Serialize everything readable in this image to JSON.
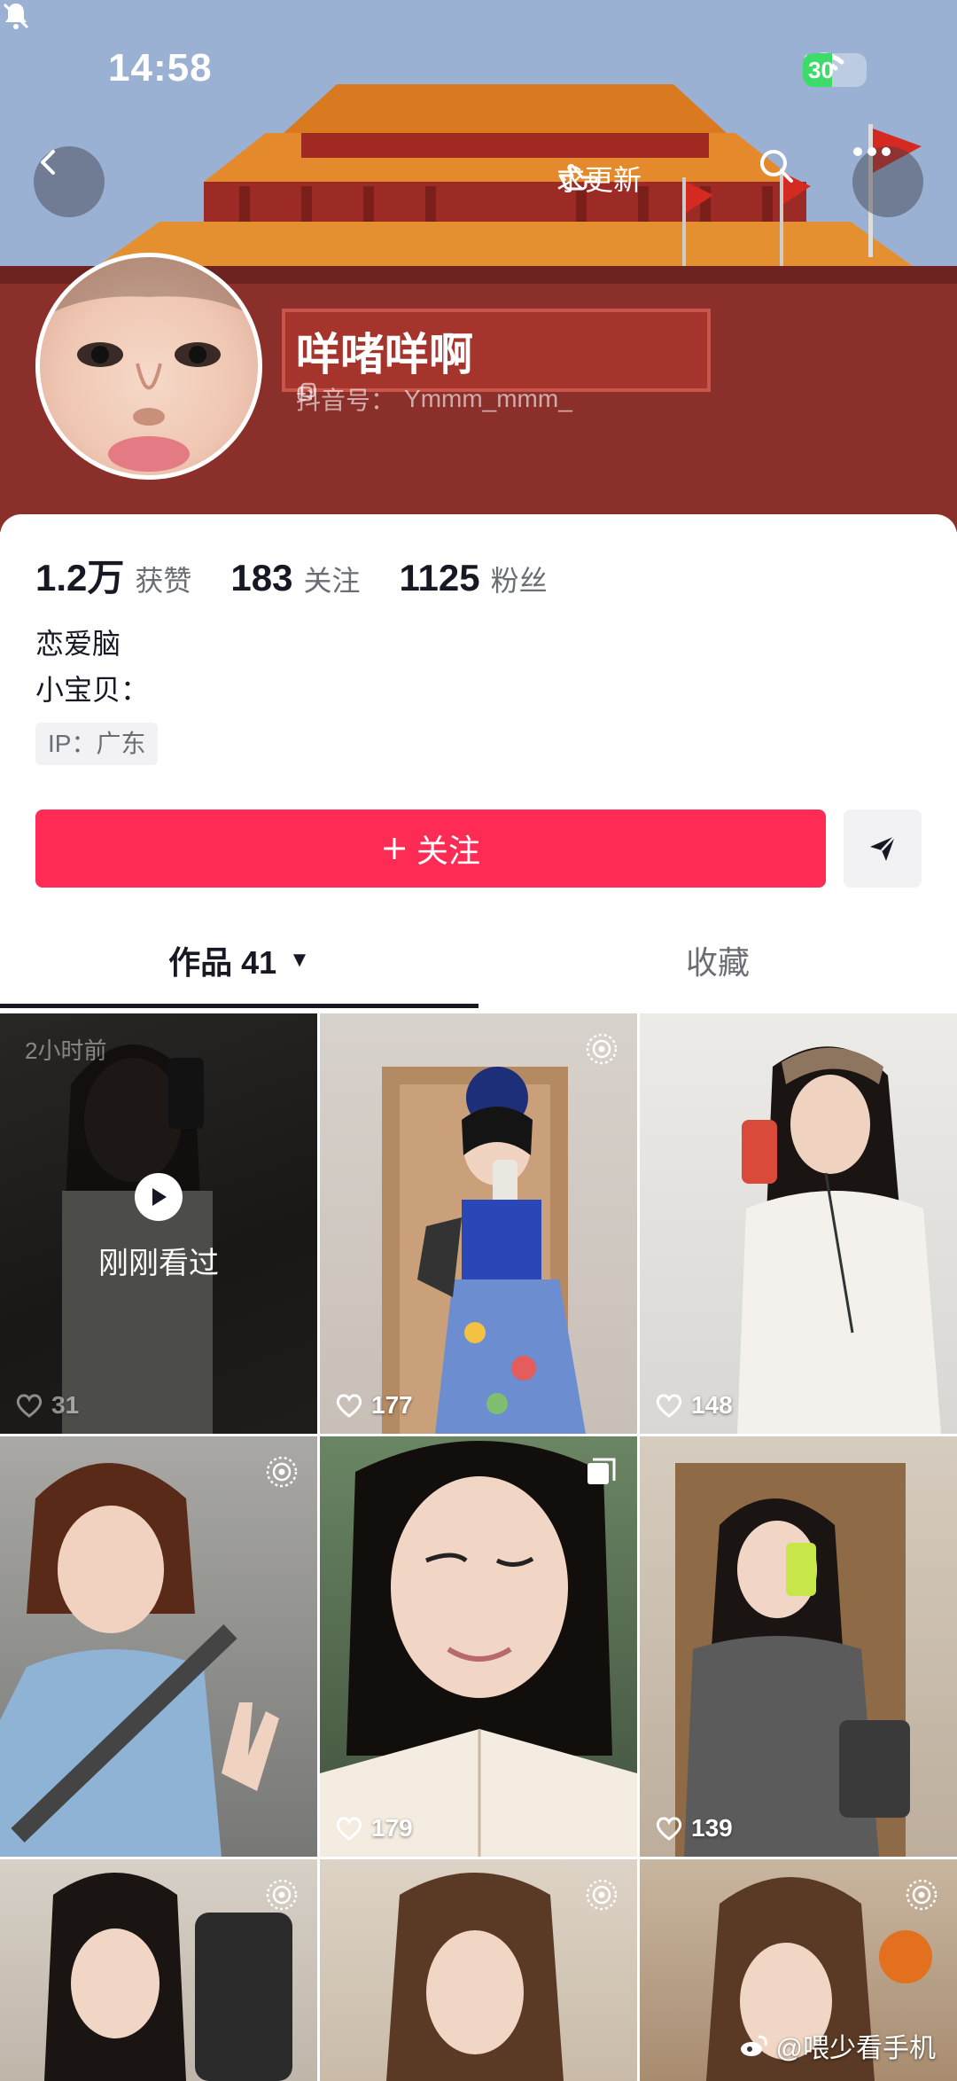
{
  "status_bar": {
    "time": "14:58",
    "battery": "30"
  },
  "header": {
    "update_label": "求更新",
    "nickname": "咩啫咩啊",
    "douyin_id_label": "抖音号：",
    "douyin_id": "Ymmm_mmm_"
  },
  "stats": [
    {
      "num": "1.2万",
      "label": "获赞"
    },
    {
      "num": "183",
      "label": "关注"
    },
    {
      "num": "1125",
      "label": "粉丝"
    }
  ],
  "bio": {
    "line1": "恋爱脑",
    "line2": "小宝贝："
  },
  "ip": "IP：广东",
  "follow_label": "关注",
  "tabs": {
    "works": "作品 41",
    "favorites": "收藏"
  },
  "videos": [
    {
      "likes": "31",
      "time_ago": "2小时前",
      "watched_label": "刚刚看过"
    },
    {
      "likes": "177"
    },
    {
      "likes": "148"
    },
    {
      "likes": ""
    },
    {
      "likes": "179"
    },
    {
      "likes": "139"
    },
    {
      "likes": ""
    },
    {
      "likes": ""
    },
    {
      "likes": ""
    }
  ],
  "watermark": "@喂少看手机"
}
